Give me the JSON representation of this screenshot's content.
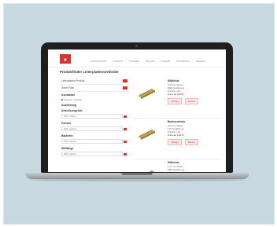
{
  "site": {
    "logo_text": "▣",
    "nav": [
      "Unternehmen",
      "Karriere",
      "Produkte",
      "Service",
      "Kontakt",
      "Downloads",
      "Messen"
    ],
    "page_title": "Produktfinder Leiterplattenverbinder"
  },
  "sidebar": {
    "top_rows": [
      "Leiterplatten Produkt",
      "Reset Filter"
    ],
    "sections": [
      {
        "title": "Kontaktart",
        "checkbox": "Buchse / Stecker",
        "select": "Bitte wählen"
      },
      {
        "title": "Ausführung",
        "checkbox": "",
        "select": ""
      },
      {
        "title": "Anschlussgröße",
        "checkbox": "",
        "select": "Bitte wählen"
      },
      {
        "title": "Polzahl",
        "checkbox": "",
        "select": "Bitte wählen"
      },
      {
        "title": "Bauhöhe",
        "checkbox": "",
        "select": "Bitte wählen"
      },
      {
        "title": "Stiftlänge",
        "checkbox": "",
        "select": "Bitte wählen"
      }
    ]
  },
  "results": [
    {
      "title": "Stiftleiste",
      "lines": [
        "2,54 mm Raster",
        "SMD Ausführung",
        "Polzahl 2–50"
      ],
      "price": "Preis ab",
      "price_value": "0,23 €",
      "actions": [
        "Anfrage",
        "Merken"
      ]
    },
    {
      "title": "Buchsenleiste",
      "lines": [
        "2,54 mm Raster",
        "THT Ausführung",
        "Polzahl 2–40"
      ],
      "price": "Preis ab",
      "price_value": "0,31 €",
      "actions": [
        "Anfrage",
        "Merken"
      ]
    },
    {
      "title": "Stiftleiste",
      "lines": [
        "1,27 mm Raster",
        "SMD Ausführung"
      ],
      "price": "",
      "price_value": "",
      "actions": []
    }
  ],
  "colors": {
    "accent": "#d5362b",
    "backdrop": "#c8d8e0"
  }
}
